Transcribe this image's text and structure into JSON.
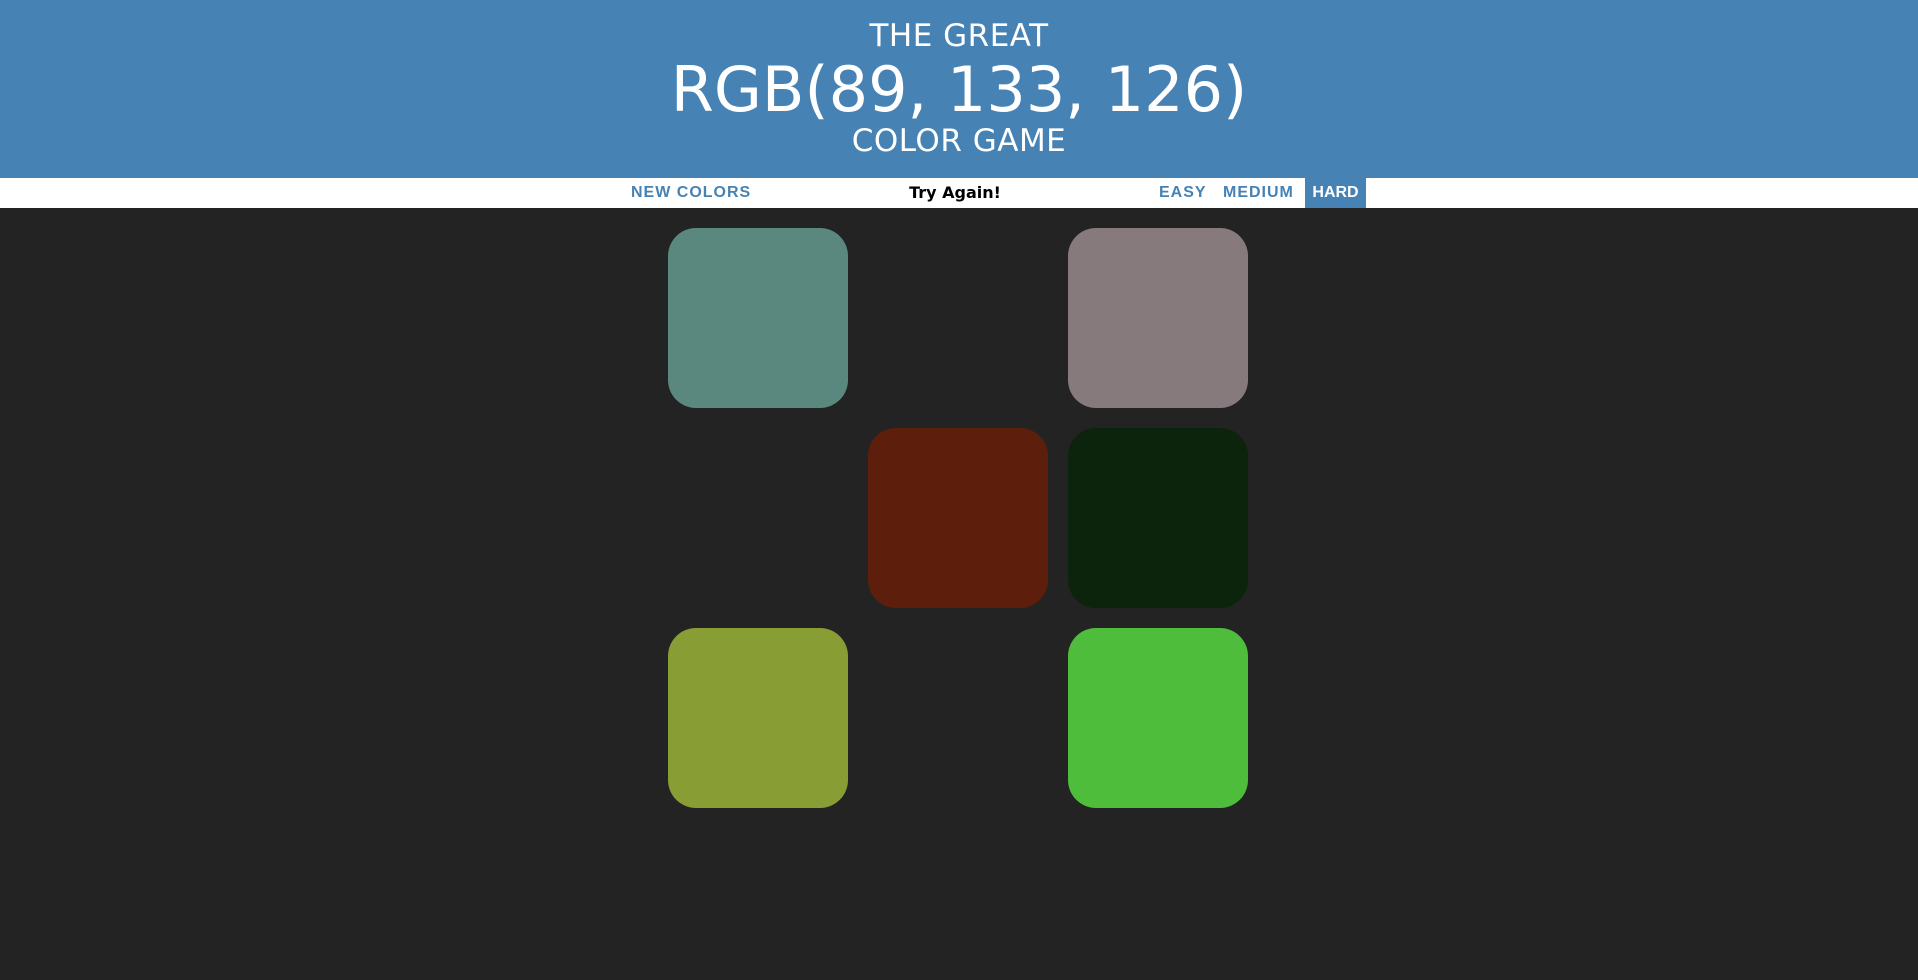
{
  "header": {
    "line1": "THE GREAT",
    "target_rgb": "RGB(89, 133, 126)",
    "line3": "COLOR GAME",
    "color": "#4682b4"
  },
  "stripe": {
    "new_colors_label": "NEW COLORS",
    "message": "Try Again!",
    "modes": [
      "EASY",
      "MEDIUM",
      "HARD"
    ],
    "selected_mode": "HARD"
  },
  "background_color": "#232323",
  "squares": [
    {
      "color": "#5a887f",
      "hidden": false
    },
    {
      "color": "#232323",
      "hidden": true
    },
    {
      "color": "#877a7d",
      "hidden": false
    },
    {
      "color": "#232323",
      "hidden": true
    },
    {
      "color": "#5e1e0c",
      "hidden": false
    },
    {
      "color": "#0c230c",
      "hidden": false
    },
    {
      "color": "#889e35",
      "hidden": false
    },
    {
      "color": "#232323",
      "hidden": true
    },
    {
      "color": "#4ebd3c",
      "hidden": false
    }
  ]
}
